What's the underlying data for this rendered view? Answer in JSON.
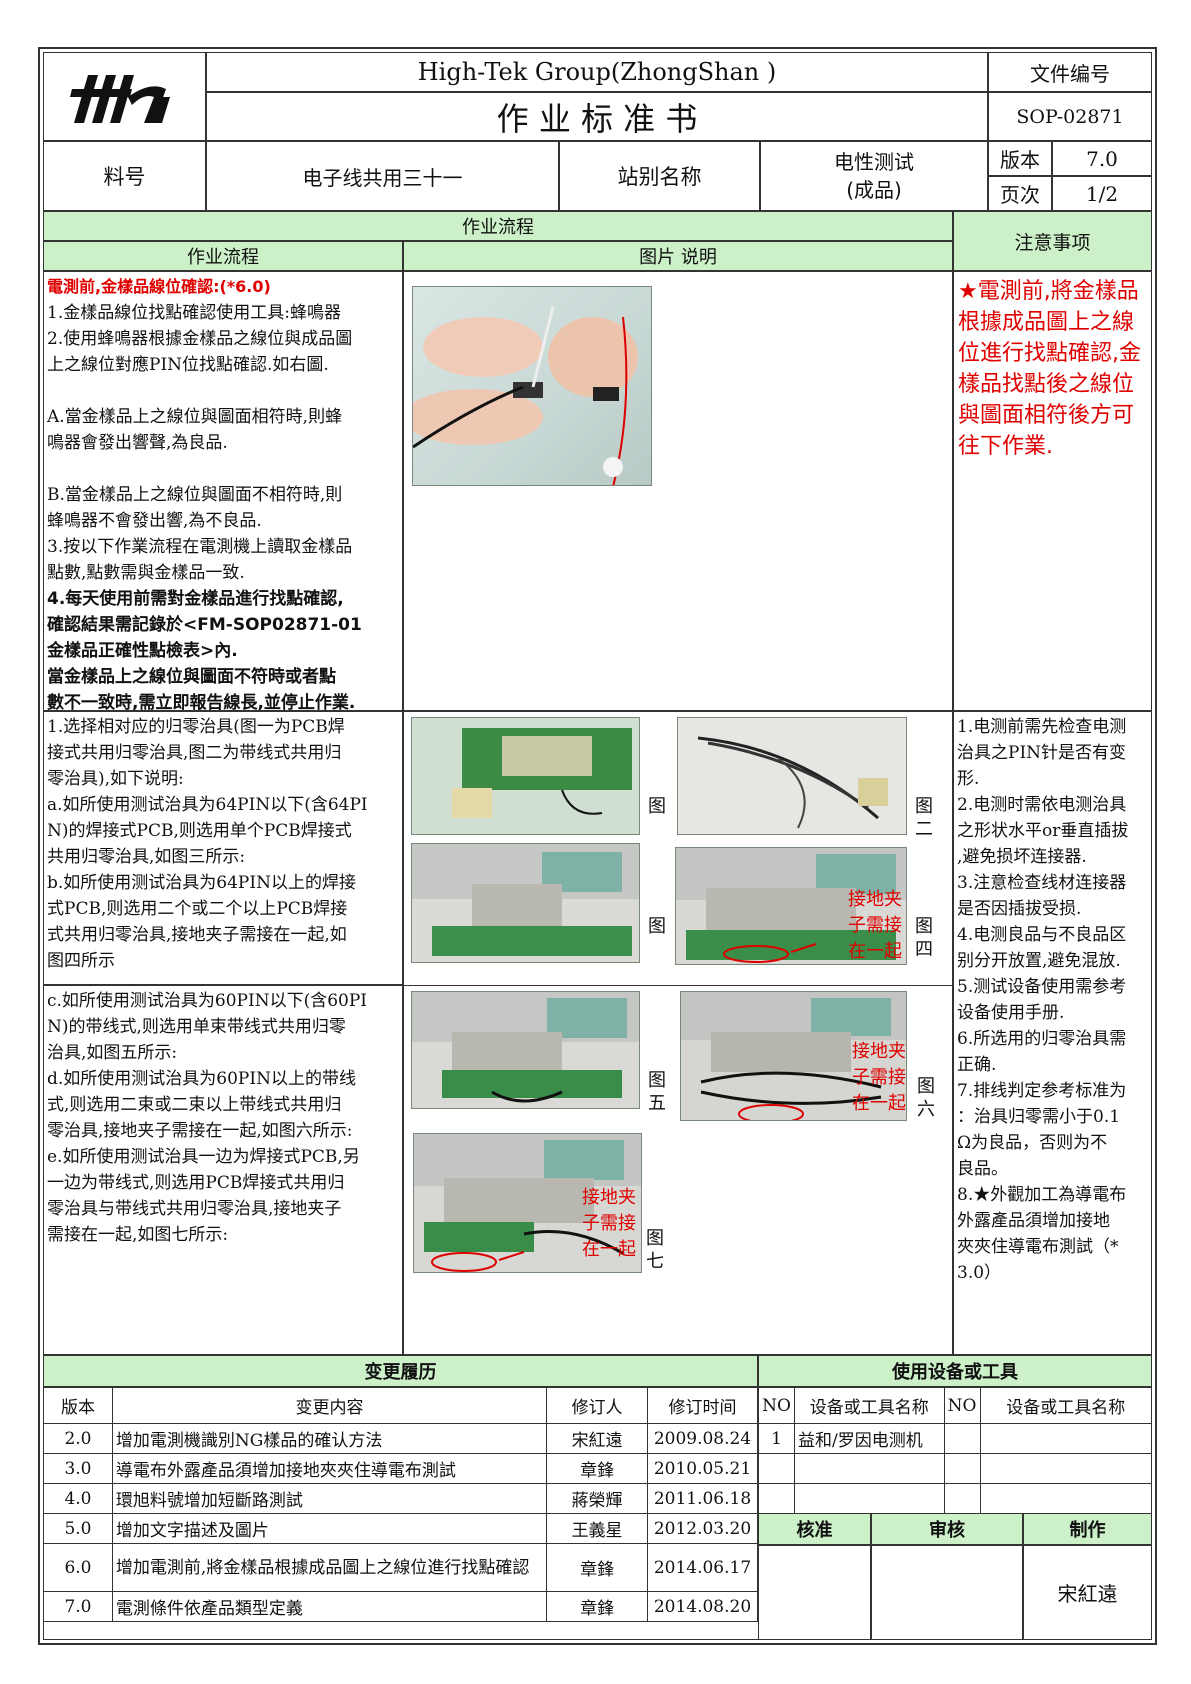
{
  "header": {
    "company": "High-Tek Group(ZhongShan )",
    "doc_title": "作 业 标 准 书",
    "doc_no_label": "文件编号",
    "doc_no": "SOP-02871",
    "part_label": "料号",
    "part_value": "电子线共用三十一",
    "station_label": "站别名称",
    "station_value_1": "电性测试",
    "station_value_2": "(成品)",
    "version_label": "版本",
    "version_value": "7.0",
    "page_label": "页次",
    "page_value": "1/2"
  },
  "section_headers": {
    "process": "作业流程",
    "process_sub": "作业流程",
    "photo_desc": "图片 说明",
    "notes": "注意事项"
  },
  "top_block": {
    "heading": "電測前,金樣品線位確認:(*6.0)",
    "lines": [
      "1.金樣品線位找點確認使用工具:蜂鳴器",
      "2.使用蜂鳴器根據金樣品之線位與成品圖",
      "上之線位對應PIN位找點確認.如右圖.",
      "",
      "A.當金樣品上之線位與圖面相符時,則蜂",
      "鳴器會發出響聲,為良品.",
      "",
      "B.當金樣品上之線位與圖面不相符時,則",
      "蜂鳴器不會發出響,為不良品.",
      "3.按以下作業流程在電測機上讀取金樣品",
      "點數,點數需與金樣品一致."
    ],
    "bold_lines": [
      "4.每天使用前需對金樣品進行找點確認,",
      "確認結果需記錄於<FM-SOP02871-01",
      "金樣品正確性點檢表>內.",
      "當金樣品上之線位與圖面不符時或者點",
      "數不一致時,需立即報告線長,並停止作業."
    ],
    "note": "★電測前,將金樣品根據成品圖上之線位進行找點確認,金樣品找點後之線位與圖面相符後方可往下作業."
  },
  "mid_block": {
    "lines": [
      "1.选择相对应的归零治具(图一为PCB焊",
      "接式共用归零治具,图二为带线式共用归",
      "零治具),如下说明:",
      "a.如所使用测试治具为64PIN以下(含64PI",
      "N)的焊接式PCB,则选用单个PCB焊接式",
      "共用归零治具,如图三所示:",
      "b.如所使用测试治具为64PIN以上的焊接",
      "式PCB,则选用二个或二个以上PCB焊接",
      "式共用归零治具,接地夹子需接在一起,如",
      "图四所示"
    ]
  },
  "low_block": {
    "lines": [
      "c.如所使用测试治具为60PIN以下(含60PI",
      "N)的带线式,则选用单束带线式共用归零",
      "治具,如图五所示:",
      "d.如所使用测试治具为60PIN以上的带线",
      "式,则选用二束或二束以上带线式共用归",
      "零治具,接地夹子需接在一起,如图六所示:",
      "e.如所使用测试治具一边为焊接式PCB,另",
      "一边为带线式,则选用PCB焊接式共用归",
      "零治具与带线式共用归零治具,接地夹子",
      "需接在一起,如图七所示:"
    ]
  },
  "figure_labels": {
    "fig1": "图",
    "fig2": [
      "图",
      "二"
    ],
    "fig3": "图",
    "fig4": [
      "图",
      "四"
    ],
    "fig5": [
      "图",
      "五"
    ],
    "fig6": [
      "图",
      "六"
    ],
    "fig7": [
      "图",
      "七"
    ]
  },
  "ground_note": [
    "接地夹",
    "子需接",
    "在一起"
  ],
  "notes_list": [
    "1.电测前需先检查电测",
    "治具之PIN针是否有变",
    "形.",
    "2.电测时需依电测治具",
    "之形状水平or垂直插拔",
    ",避免损坏连接器.",
    "3.注意检查线材连接器",
    "是否因插拔受损.",
    "4.电测良品与不良品区",
    "别分开放置,避免混放.",
    "5.测试设备使用需参考",
    "设备使用手册.",
    "6.所选用的归零治具需",
    "正确.",
    "7.排线判定参考标准为",
    "：治具归零需小于0.1",
    "Ω为良品，否则为不",
    "良品。",
    "8.★外觀加工為導電布",
    "外露產品須增加接地",
    "夾夾住導電布測試（*",
    "3.0）"
  ],
  "change_history": {
    "title": "变更履历",
    "headers": [
      "版本",
      "变更内容",
      "修订人",
      "修订时间"
    ],
    "rows": [
      [
        "2.0",
        "增加電測機識別NG樣品的確认方法",
        "宋紅遠",
        "2009.08.24"
      ],
      [
        "3.0",
        "導電布外露產品須增加接地夾夾住導電布測試",
        "章鋒",
        "2010.05.21"
      ],
      [
        "4.0",
        "環旭料號增加短斷路測試",
        "蔣榮輝",
        "2011.06.18"
      ],
      [
        "5.0",
        "增加文字描述及圖片",
        "王義星",
        "2012.03.20"
      ],
      [
        "6.0",
        "增加電測前,將金樣品根據成品圖上之線位進行找點確認",
        "章鋒",
        "2014.06.17"
      ],
      [
        "7.0",
        "電測條件依產品類型定義",
        "章鋒",
        "2014.08.20"
      ]
    ]
  },
  "equipment": {
    "title": "使用设备或工具",
    "headers": [
      "NO",
      "设备或工具名称",
      "NO",
      "设备或工具名称"
    ],
    "rows": [
      [
        "1",
        "益和/罗因电测机",
        "",
        ""
      ],
      [
        "",
        "",
        "",
        ""
      ],
      [
        "",
        "",
        "",
        ""
      ]
    ]
  },
  "approval": {
    "labels": [
      "核准",
      "审核",
      "制作"
    ],
    "maker": "宋紅遠"
  },
  "colors": {
    "section_green": "#ccf0c8",
    "red_text": "#e00000",
    "annotation_red": "#e00000"
  }
}
